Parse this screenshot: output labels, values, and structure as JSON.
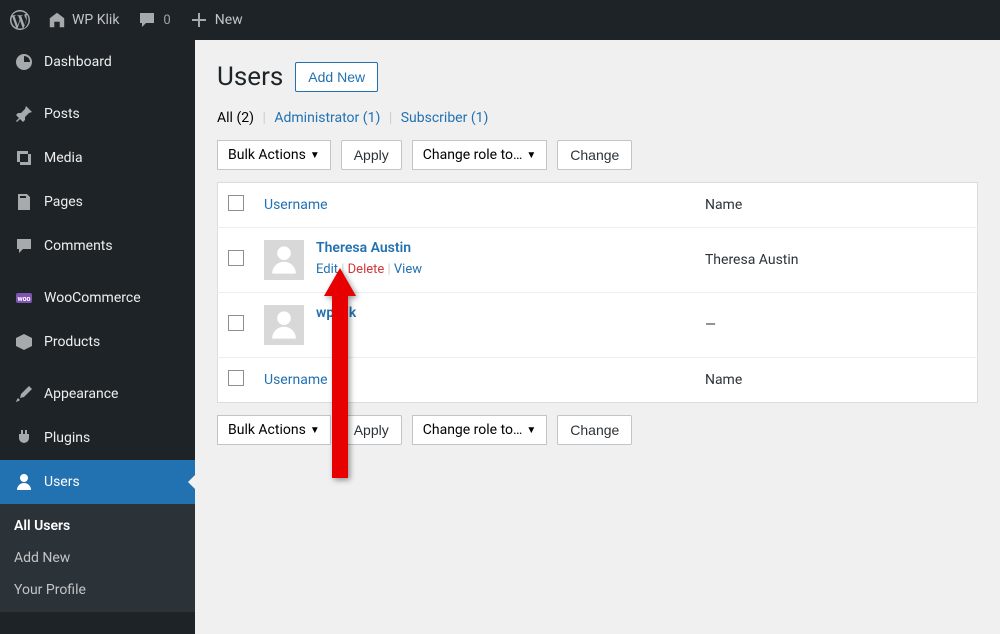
{
  "adminbar": {
    "site_name": "WP Klik",
    "comments_count": "0",
    "new_label": "New"
  },
  "sidebar": {
    "items": [
      {
        "label": "Dashboard"
      },
      {
        "label": "Posts"
      },
      {
        "label": "Media"
      },
      {
        "label": "Pages"
      },
      {
        "label": "Comments"
      },
      {
        "label": "WooCommerce"
      },
      {
        "label": "Products"
      },
      {
        "label": "Appearance"
      },
      {
        "label": "Plugins"
      },
      {
        "label": "Users"
      }
    ],
    "submenu": [
      {
        "label": "All Users"
      },
      {
        "label": "Add New"
      },
      {
        "label": "Your Profile"
      }
    ]
  },
  "page": {
    "title": "Users",
    "add_new": "Add New"
  },
  "filters": {
    "all_label": "All",
    "all_count": "(2)",
    "admin_label": "Administrator",
    "admin_count": "(1)",
    "subscriber_label": "Subscriber",
    "subscriber_count": "(1)"
  },
  "actions": {
    "bulk_label": "Bulk Actions",
    "apply_label": "Apply",
    "role_label": "Change role to…",
    "change_label": "Change"
  },
  "table": {
    "col_username": "Username",
    "col_name": "Name",
    "rows": [
      {
        "username": "Theresa Austin",
        "name": "Theresa Austin",
        "edit": "Edit",
        "delete": "Delete",
        "view": "View"
      },
      {
        "username": "wpklik",
        "name": "—"
      }
    ]
  }
}
